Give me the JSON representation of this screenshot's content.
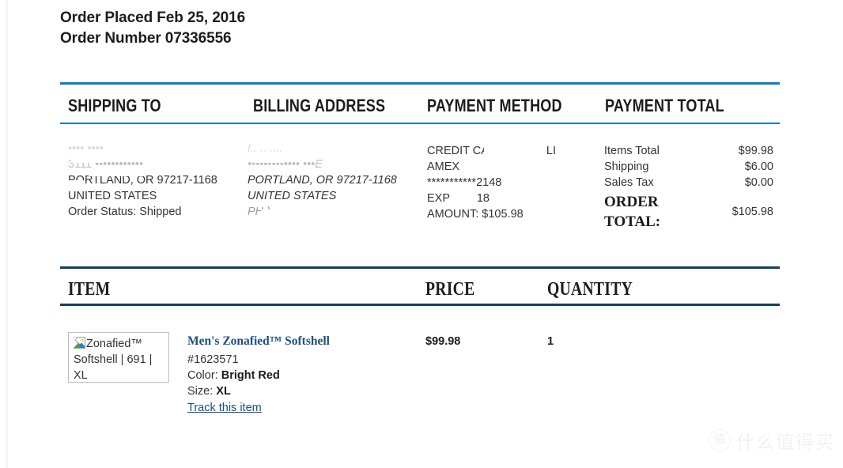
{
  "order": {
    "placed_line": "Order Placed Feb 25, 2016",
    "number_line": "Order Number 07336556"
  },
  "summary_table": {
    "headers": {
      "shipping": "SHIPPING TO",
      "billing": "BILLING ADDRESS",
      "payment_method": "PAYMENT METHOD",
      "payment_total": "PAYMENT TOTAL"
    },
    "shipping": {
      "name_redacted": "•••• ••••",
      "street_redacted": "3111   ••••••••••••",
      "city_state_zip": "PORTLAND,  OR  97217-1168",
      "country": "UNITED STATES",
      "status": "Order Status: Shipped"
    },
    "billing": {
      "name_redacted": "I.. .. ....",
      "street_redacted": "•••••••••••••  •••E",
      "city_state_zip": "PORTLAND, OR 97217-1168",
      "country": "UNITED STATES",
      "phone_redacted": "PH                        )"
    },
    "payment_method": {
      "type_line": "CREDIT CARD",
      "type_suffix": "LI",
      "brand": "AMEX",
      "card_number": "***********2148",
      "exp_label": "EXP",
      "exp_value": "18",
      "amount": "AMOUNT: $105.98"
    },
    "payment_total": {
      "rows": [
        {
          "label": "Items Total",
          "value": "$99.98"
        },
        {
          "label": "Shipping",
          "value": "$6.00"
        },
        {
          "label": "Sales Tax",
          "value": "$0.00"
        }
      ],
      "grand_label": "ORDER TOTAL:",
      "grand_value": "$105.98"
    }
  },
  "item_table": {
    "headers": {
      "item": "ITEM",
      "price": "PRICE",
      "quantity": "QUANTITY"
    },
    "row": {
      "thumbnail_alt": "Zonafied™ Softshell | 691 | XL",
      "title": "Men's Zonafied™ Softshell",
      "sku": "#1623571",
      "color_label": "Color:",
      "color_value": "Bright Red",
      "size_label": "Size:",
      "size_value": "XL",
      "track_link": "Track this item",
      "price": "$99.98",
      "quantity": "1"
    }
  },
  "watermark": {
    "mark": "值",
    "text": "什么值得买"
  },
  "colors": {
    "rule_blue": "#0c7cc0",
    "rule_navy": "#13405f",
    "link_blue": "#1d4f80"
  }
}
